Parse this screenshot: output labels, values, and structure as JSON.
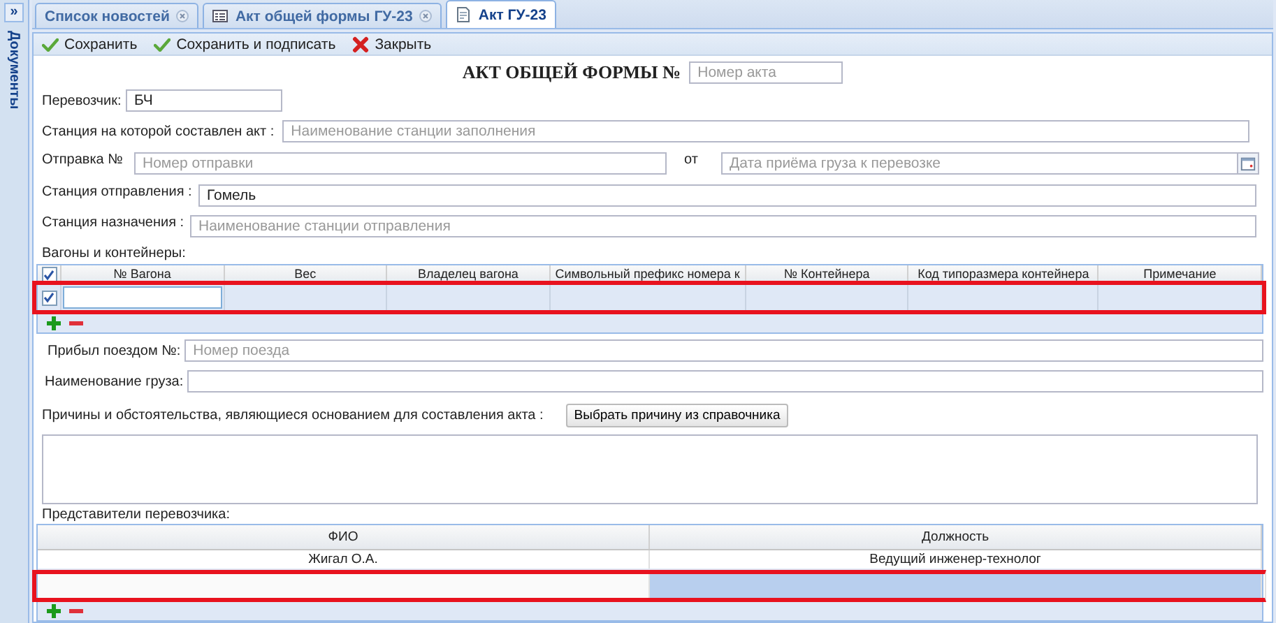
{
  "sidebar": {
    "toggle": "»",
    "title": "Документы"
  },
  "tabs": [
    {
      "label": "Список новостей",
      "closable": true,
      "selected": false
    },
    {
      "label": "Акт общей формы ГУ-23",
      "closable": true,
      "selected": false
    },
    {
      "label": "Акт ГУ-23",
      "closable": false,
      "selected": true
    }
  ],
  "toolbar": [
    {
      "label": "Сохранить"
    },
    {
      "label": "Сохранить и подписать"
    },
    {
      "label": "Закрыть"
    }
  ],
  "form": {
    "title": "АКТ ОБЩЕЙ ФОРМЫ №",
    "act_number": {
      "placeholder": "Номер акта"
    },
    "carrier": {
      "label": "Перевозчик:",
      "value": "БЧ"
    },
    "station_made": {
      "label": "Станция на которой составлен акт :",
      "placeholder": "Наименование станции заполнения"
    },
    "shipment": {
      "label": "Отправка №",
      "placeholder": "Номер отправки",
      "from_label": "от",
      "date_placeholder": "Дата приёма груза к перевозке"
    },
    "departure": {
      "label": "Станция отправления :",
      "value": "Гомель"
    },
    "destination": {
      "label": "Станция назначения :",
      "placeholder": "Наименование станции отправления"
    },
    "wagons": {
      "label": "Вагоны и контейнеры:",
      "all_checked": true,
      "columns": [
        "№ Вагона",
        "Вес",
        "Владелец вагона",
        "Символьный префикс номера к",
        "№ Контейнера",
        "Код типоразмера контейнера",
        "Примечание"
      ],
      "rows": [
        {
          "checked": true,
          "editing": true,
          "highlighted": true
        }
      ]
    },
    "train": {
      "label": "Прибыл поездом №:",
      "placeholder": "Номер поезда"
    },
    "cargo": {
      "label": "Наименование груза:"
    },
    "reasons": {
      "label": "Причины и обстоятельства, являющиеся основанием для составления акта :",
      "button": "Выбрать причину из справочника"
    },
    "representatives": {
      "label": "Представители перевозчика:",
      "columns": [
        "ФИО",
        "Должность"
      ],
      "rows": [
        {
          "fio": "Жигал О.А.",
          "position": "Ведущий инженер-технолог",
          "selected": false,
          "highlighted": false
        },
        {
          "selected": true,
          "highlighted": true
        }
      ]
    }
  }
}
